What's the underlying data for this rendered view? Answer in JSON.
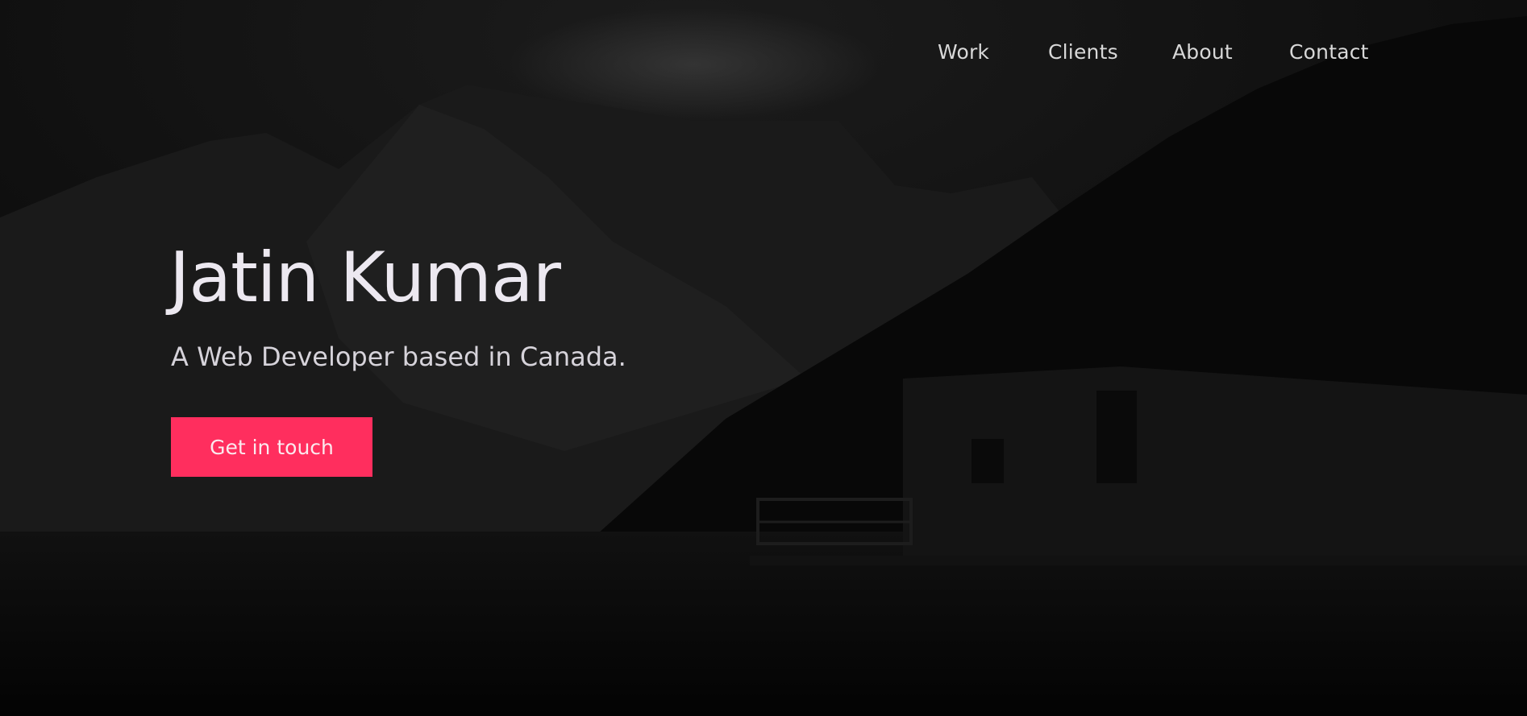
{
  "nav": {
    "items": [
      {
        "label": "Work"
      },
      {
        "label": "Clients"
      },
      {
        "label": "About"
      },
      {
        "label": "Contact"
      }
    ]
  },
  "hero": {
    "title": "Jatin Kumar",
    "subtitle": "A Web Developer based in Canada.",
    "cta_label": "Get in touch",
    "background_icon": "mountain-lake-cabin-photo"
  },
  "colors": {
    "accent": "#ff2e5e",
    "background": "#050505",
    "text": "#ece8f0"
  }
}
